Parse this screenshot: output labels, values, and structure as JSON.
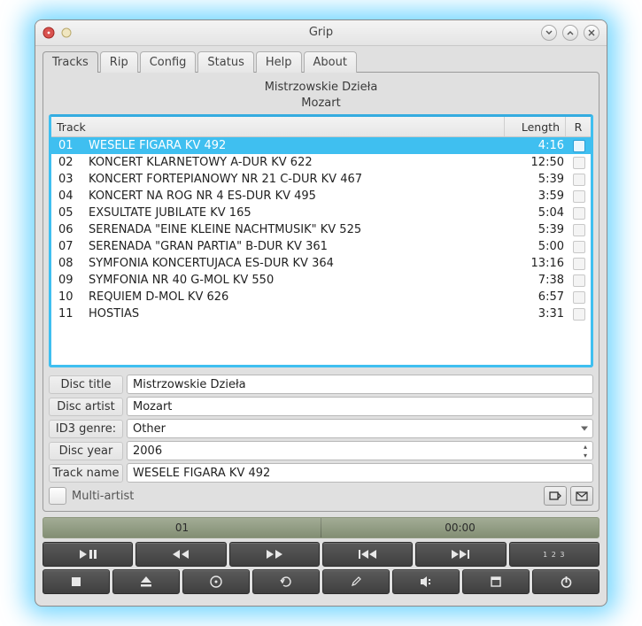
{
  "window": {
    "title": "Grip"
  },
  "tabs": [
    {
      "label": "Tracks",
      "active": true
    },
    {
      "label": "Rip"
    },
    {
      "label": "Config"
    },
    {
      "label": "Status"
    },
    {
      "label": "Help"
    },
    {
      "label": "About"
    }
  ],
  "album": {
    "title_line1": "Mistrzowskie Dzieła",
    "title_line2": "Mozart"
  },
  "columns": {
    "track": "Track",
    "length": "Length",
    "rip": "R"
  },
  "tracks": [
    {
      "num": "01",
      "name": "WESELE FIGARA KV 492",
      "length": "4:16",
      "selected": true
    },
    {
      "num": "02",
      "name": "KONCERT KLARNETOWY A-DUR KV 622",
      "length": "12:50"
    },
    {
      "num": "03",
      "name": "KONCERT FORTEPIANOWY NR 21 C-DUR KV 467",
      "length": "5:39"
    },
    {
      "num": "04",
      "name": "KONCERT NA RÓG NR 4 ES-DUR KV 495",
      "length": "3:59"
    },
    {
      "num": "05",
      "name": "EXSULTATE JUBILATE KV 165",
      "length": "5:04"
    },
    {
      "num": "06",
      "name": "SERENADA \"EINE KLEINE NACHTMUSIK\" KV 525",
      "length": "5:39"
    },
    {
      "num": "07",
      "name": "SERENADA \"GRAN PARTIA\" B-DUR KV 361",
      "length": "5:00"
    },
    {
      "num": "08",
      "name": "SYMFONIA KONCERTUJACA ES-DUR KV 364",
      "length": "13:16"
    },
    {
      "num": "09",
      "name": "SYMFONIA NR 40 G-MOL KV 550",
      "length": "7:38"
    },
    {
      "num": "10",
      "name": "REQUIEM D-MOL KV 626",
      "length": "6:57"
    },
    {
      "num": "11",
      "name": "HOSTIAS",
      "length": "3:31"
    }
  ],
  "meta": {
    "disc_title_label": "Disc title",
    "disc_title": "Mistrzowskie Dzieła",
    "disc_artist_label": "Disc artist",
    "disc_artist": "Mozart",
    "id3_genre_label": "ID3 genre:",
    "id3_genre": "Other",
    "disc_year_label": "Disc year",
    "disc_year": "2006",
    "track_name_label": "Track name",
    "track_name": "WESELE FIGARA KV 492",
    "multi_artist_label": "Multi-artist"
  },
  "progress": {
    "current_track": "01",
    "time": "00:00"
  },
  "player_numbers_label": "1 2 3"
}
